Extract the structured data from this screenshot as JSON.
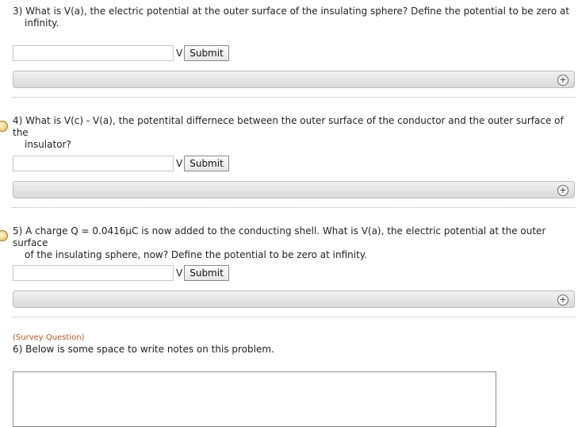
{
  "questions": [
    {
      "number": "3)",
      "text_line1": "What is V(a), the electric potential at the outer surface of the insulating sphere? Define the potential to be zero at",
      "text_line2": "infinity.",
      "answer_value": "",
      "unit": "V",
      "submit_label": "Submit",
      "expand_icon": "plus-icon"
    },
    {
      "number": "4)",
      "text_line1": "What is V(c) - V(a), the potentital differnece between the outer surface of the conductor and the outer surface of the",
      "text_line2": "insulator?",
      "answer_value": "",
      "unit": "V",
      "submit_label": "Submit",
      "expand_icon": "plus-icon"
    },
    {
      "number": "5)",
      "text_line1": "A charge Q = 0.0416μC is now added to the conducting shell. What is V(a), the electric potential at the outer surface",
      "text_line2": "of the insulating sphere, now? Define the potential to be zero at infinity.",
      "answer_value": "",
      "unit": "V",
      "submit_label": "Submit",
      "expand_icon": "plus-icon"
    }
  ],
  "survey": {
    "tag": "(Survey Question)",
    "number": "6)",
    "text": "Below is some space to write notes on this problem.",
    "notes_value": ""
  },
  "colors": {
    "survey_tag": "#b5562b",
    "hint_bar_top": "#f1f1f1",
    "hint_bar_bottom": "#d9d9d9"
  }
}
